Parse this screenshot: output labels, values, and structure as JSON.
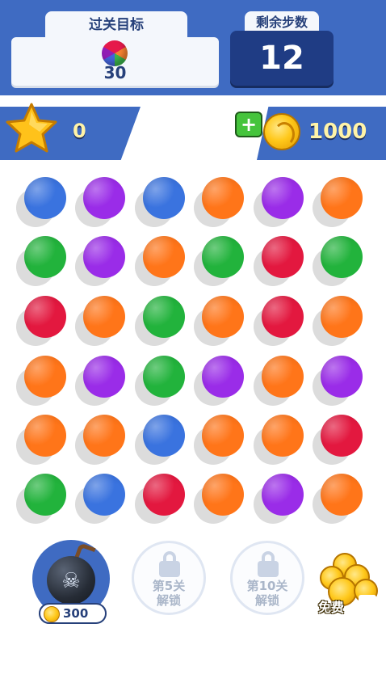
{
  "header": {
    "goal_title": "过关目标",
    "goal_count": "30",
    "steps_title": "剩余步数",
    "steps_value": "12"
  },
  "status": {
    "score": "0",
    "coins": "1000",
    "add_coins_symbol": "+"
  },
  "colors": {
    "blue": "#3a73df",
    "purple": "#9a2ce8",
    "orange": "#ff7519",
    "green": "#22b33c",
    "red": "#e3183f",
    "header_blue": "#3f6bc2",
    "navy": "#1f3c84"
  },
  "board": {
    "rows": [
      [
        "blue",
        "purple",
        "blue",
        "orange",
        "purple",
        "orange"
      ],
      [
        "green",
        "purple",
        "orange",
        "green",
        "red",
        "green"
      ],
      [
        "red",
        "orange",
        "green",
        "orange",
        "red",
        "orange"
      ],
      [
        "orange",
        "purple",
        "green",
        "purple",
        "orange",
        "purple"
      ],
      [
        "orange",
        "orange",
        "blue",
        "orange",
        "orange",
        "red"
      ],
      [
        "green",
        "blue",
        "red",
        "orange",
        "purple",
        "orange"
      ]
    ]
  },
  "tools": {
    "bomb": {
      "icon": "bomb-icon",
      "price": "300"
    },
    "locked_1": {
      "line1": "第5关",
      "line2": "解锁"
    },
    "locked_2": {
      "line1": "第10关",
      "line2": "解锁"
    },
    "free": {
      "label": "免费"
    }
  }
}
